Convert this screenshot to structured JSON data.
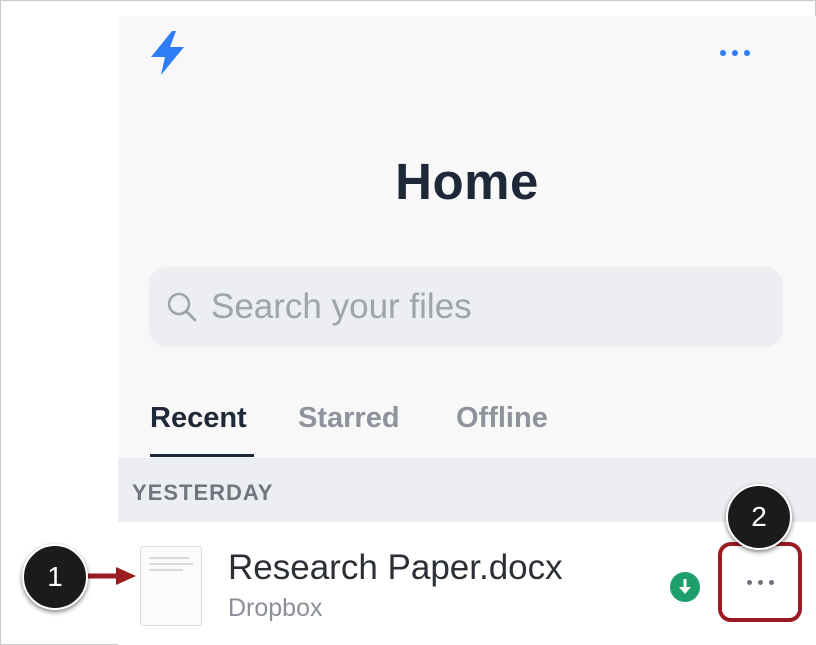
{
  "header": {
    "logo_icon": "bolt-icon",
    "more_icon": "more-horizontal-icon",
    "title": "Home"
  },
  "search": {
    "placeholder": "Search your files",
    "icon": "search-icon"
  },
  "tabs": [
    {
      "label": "Recent",
      "active": true
    },
    {
      "label": "Starred",
      "active": false
    },
    {
      "label": "Offline",
      "active": false
    }
  ],
  "section": {
    "label": "YESTERDAY"
  },
  "file": {
    "name": "Research Paper.docx",
    "location": "Dropbox",
    "status_icon": "download-icon",
    "more_icon": "more-horizontal-icon"
  },
  "callouts": [
    {
      "number": "1"
    },
    {
      "number": "2"
    }
  ],
  "colors": {
    "accent": "#2f7df6",
    "title": "#1e2838",
    "download": "#1e9e6b",
    "callout_highlight": "#9b1b23"
  }
}
